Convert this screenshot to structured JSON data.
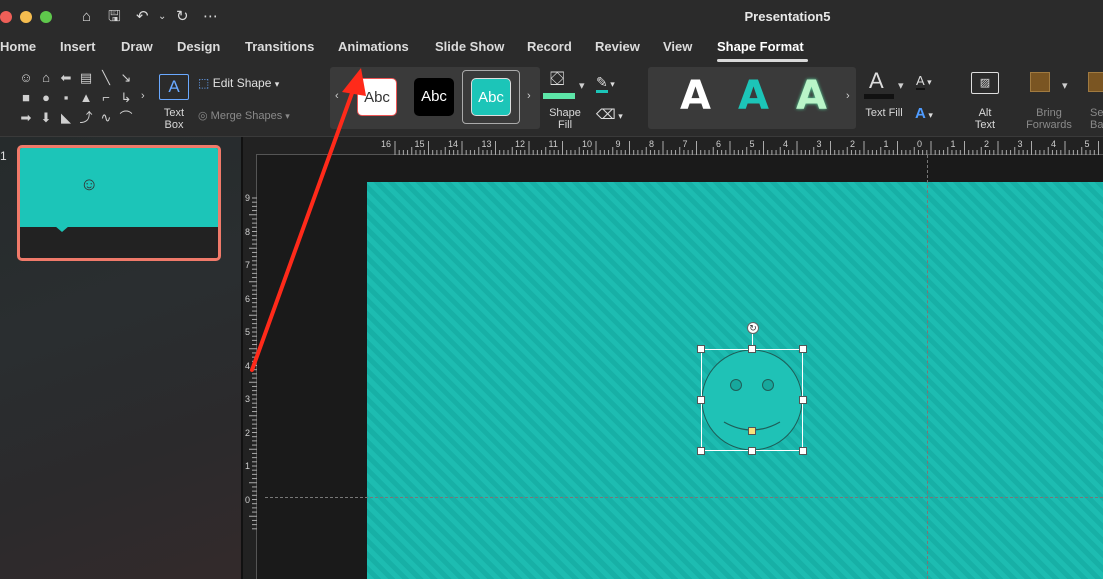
{
  "window": {
    "title": "Presentation5"
  },
  "tabs": [
    "Home",
    "Insert",
    "Draw",
    "Design",
    "Transitions",
    "Animations",
    "Slide Show",
    "Record",
    "Review",
    "View",
    "Shape Format"
  ],
  "ribbon": {
    "text_box_label": "Text\nBox",
    "edit_shape_label": "Edit Shape",
    "merge_shapes_label": "Merge Shapes",
    "style_swatch_label": "Abc",
    "shape_fill_label": "Shape\nFill",
    "wordart_letter": "A",
    "text_fill_label": "Text Fill",
    "alt_text_label": "Alt\nText",
    "bring_forwards_label": "Bring\nForwards",
    "send_backward_partial": "Se\nBack"
  },
  "slide_pane": {
    "slide_number": "1"
  },
  "ruler": {
    "horizontal": [
      "16",
      "15",
      "14",
      "13",
      "12",
      "11",
      "10",
      "9",
      "8",
      "7",
      "6",
      "5",
      "4",
      "3",
      "2",
      "1",
      "0",
      "1",
      "2",
      "3",
      "4",
      "5"
    ],
    "vertical": [
      "9",
      "8",
      "7",
      "6",
      "5",
      "4",
      "3",
      "2",
      "1",
      "0"
    ]
  },
  "colors": {
    "slide_teal": "#1dbcb1",
    "annotation_arrow": "#ff2a1a",
    "thumbnail_border": "#f07a6a",
    "shape_fill_bar": "#5de6a8"
  },
  "icons": [
    "home-icon",
    "save-icon",
    "undo-icon",
    "redo-icon",
    "more-icon",
    "smiley-shape"
  ]
}
